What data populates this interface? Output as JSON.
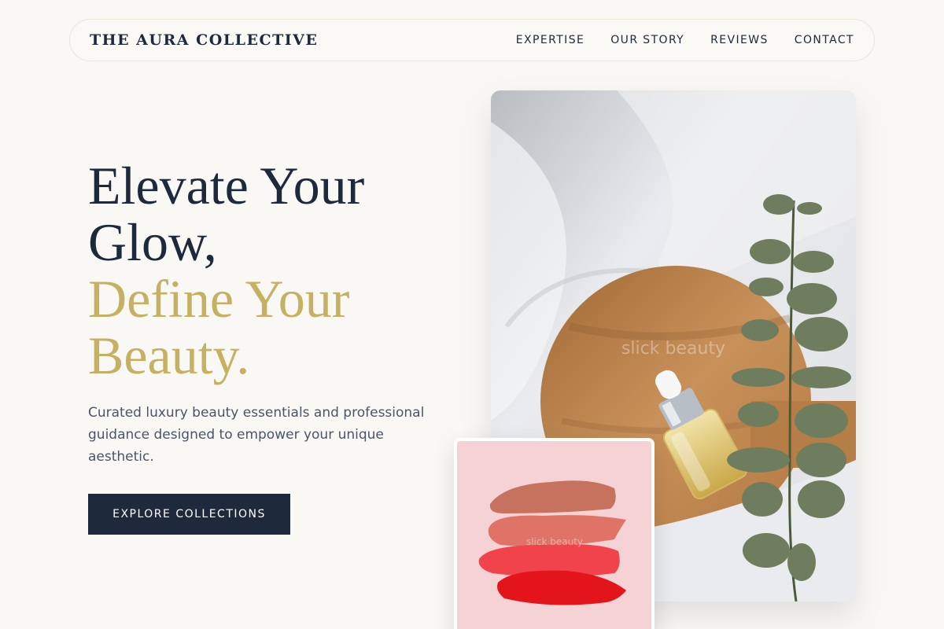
{
  "brand": {
    "name": "THE AURA COLLECTIVE"
  },
  "nav": {
    "links": [
      {
        "label": "EXPERTISE"
      },
      {
        "label": "OUR STORY"
      },
      {
        "label": "REVIEWS"
      },
      {
        "label": "CONTACT"
      }
    ]
  },
  "hero": {
    "headline_line1": "Elevate Your",
    "headline_line2": "Glow,",
    "headline_line3": "Define Your",
    "headline_line4": "Beauty.",
    "subtitle": "Curated luxury beauty essentials and professional guidance designed to empower your unique aesthetic.",
    "cta_label": "EXPLORE COLLECTIONS"
  },
  "images": {
    "main_watermark": "slick beauty",
    "swatch_watermark": "slick beauty"
  },
  "colors": {
    "navy": "#1e293b",
    "gold": "#c6b061",
    "background": "#f9f8f5"
  }
}
